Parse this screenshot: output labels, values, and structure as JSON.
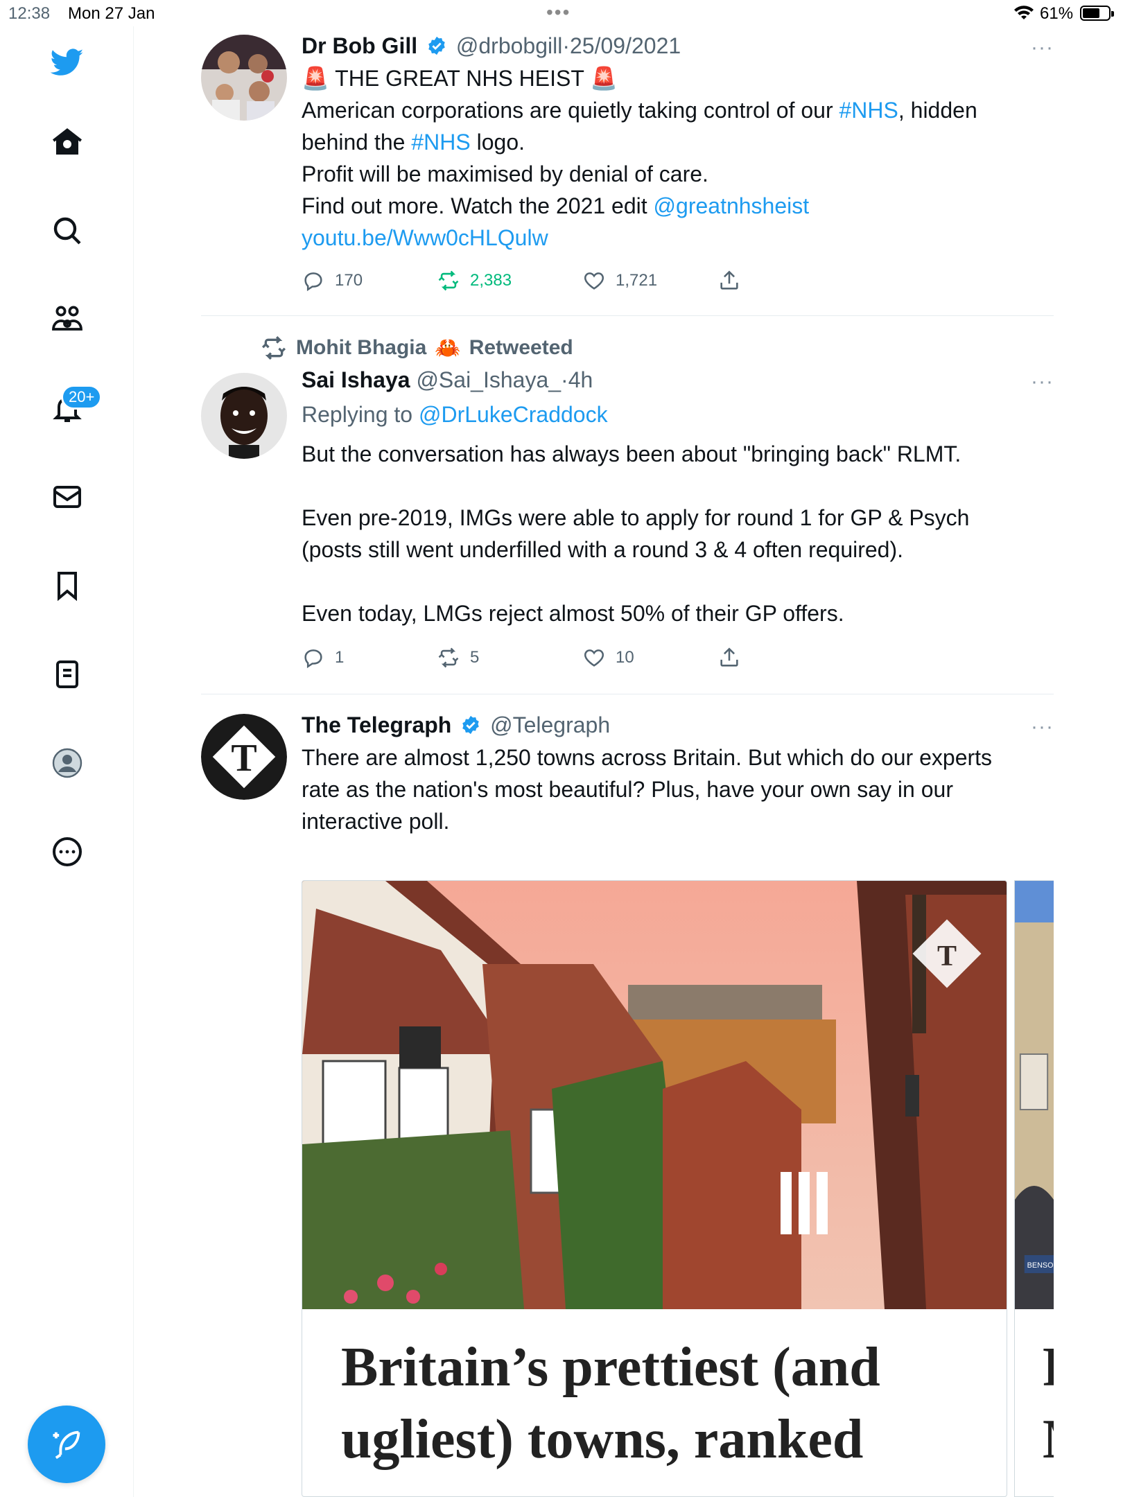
{
  "status_bar": {
    "time": "12:38",
    "date": "Mon 27 Jan",
    "battery": "61%"
  },
  "sidebar": {
    "items": [
      {
        "name": "twitter-logo-icon"
      },
      {
        "name": "home-icon"
      },
      {
        "name": "search-icon"
      },
      {
        "name": "communities-icon"
      },
      {
        "name": "notifications-icon"
      },
      {
        "name": "messages-icon"
      },
      {
        "name": "bookmarks-icon"
      },
      {
        "name": "lists-icon"
      },
      {
        "name": "profile-icon"
      },
      {
        "name": "more-icon"
      }
    ],
    "notifications_badge": "20+",
    "compose_icon": "compose-icon"
  },
  "tweets": [
    {
      "name": "Dr Bob Gill",
      "handle": "@drbobgill",
      "sep": "·",
      "time": "25/09/2021",
      "verified": true,
      "more": "···",
      "line1": "THE GREAT NHS HEIST",
      "line2_a": "American corporations are quietly taking control of our ",
      "line2_tag": "#NHS",
      "line2_b": ", hidden",
      "line3_a": "behind the ",
      "line3_tag": "#NHS",
      "line3_b": " logo.",
      "line4": "Profit will be maximised by denial of care.",
      "line5_a": "Find out more. Watch the 2021 edit ",
      "line5_mention": "@greatnhsheist",
      "line6_link": "youtu.be/Www0cHLQulw",
      "replies": "170",
      "retweets": "2,383",
      "likes": "1,721"
    },
    {
      "retweeted_by": "Mohit Bhagia",
      "retweeted_emoji": "🦀",
      "retweeted_label": "Retweeted",
      "name": "Sai Ishaya",
      "handle": "@Sai_Ishaya_",
      "sep": "·",
      "time": "4h",
      "more": "···",
      "replying_label": "Replying to ",
      "replying_to": "@DrLukeCraddock",
      "p1": "But the conversation has always been about \"bringing back\"  RLMT.",
      "p2_l1": "Even pre-2019, IMGs were able to apply for round 1 for GP & Psych",
      "p2_l2": "(posts still went underfilled with a round 3 & 4 often required).",
      "p3": "Even today, LMGs reject almost 50% of their GP offers.",
      "replies": "1",
      "retweets": "5",
      "likes": "10"
    },
    {
      "name": "The Telegraph",
      "handle": "@Telegraph",
      "verified": true,
      "more": "···",
      "l1": "There are almost 1,250 towns across Britain. But which do our experts",
      "l2": "rate as the nation's most beautiful? Plus, have your own say in our",
      "l3": "interactive poll.",
      "card_title_l1": "Britain’s prettiest (and",
      "card_title_l2": "ugliest) towns, ranked",
      "card2_title_l1": "F",
      "card2_title_l2": "M",
      "card2_sign": "BENSONS"
    }
  ],
  "colors": {
    "accent": "#1d9bf0",
    "retweet_green": "#00ba7c",
    "muted": "#536471"
  }
}
